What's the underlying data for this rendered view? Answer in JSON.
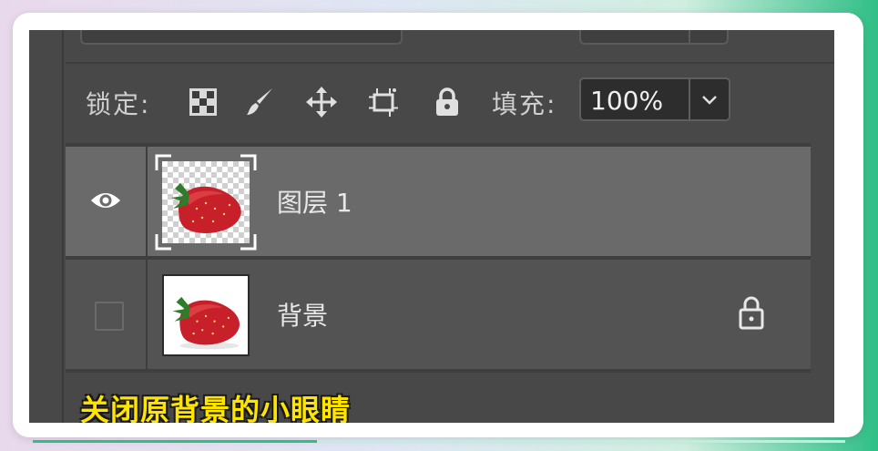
{
  "lock_row": {
    "label": "锁定:",
    "icons": [
      "lock-transparent-pixels-icon",
      "lock-image-pixels-icon",
      "lock-position-icon",
      "lock-artboard-icon",
      "lock-all-icon"
    ]
  },
  "fill": {
    "label": "填充:",
    "value": "100%"
  },
  "layers": [
    {
      "name": "图层 1",
      "visible": true,
      "selected": true,
      "thumbnail": "strawberry-transparent"
    },
    {
      "name": "背景",
      "visible": false,
      "selected": false,
      "locked": true,
      "thumbnail": "strawberry-white"
    }
  ],
  "caption": "关闭原背景的小眼睛",
  "colors": {
    "panel_bg": "#484848",
    "selected_row": "#6a6a6a",
    "caption_text": "#ffe400",
    "accent": "#2fbf86"
  },
  "progress": 0.35
}
